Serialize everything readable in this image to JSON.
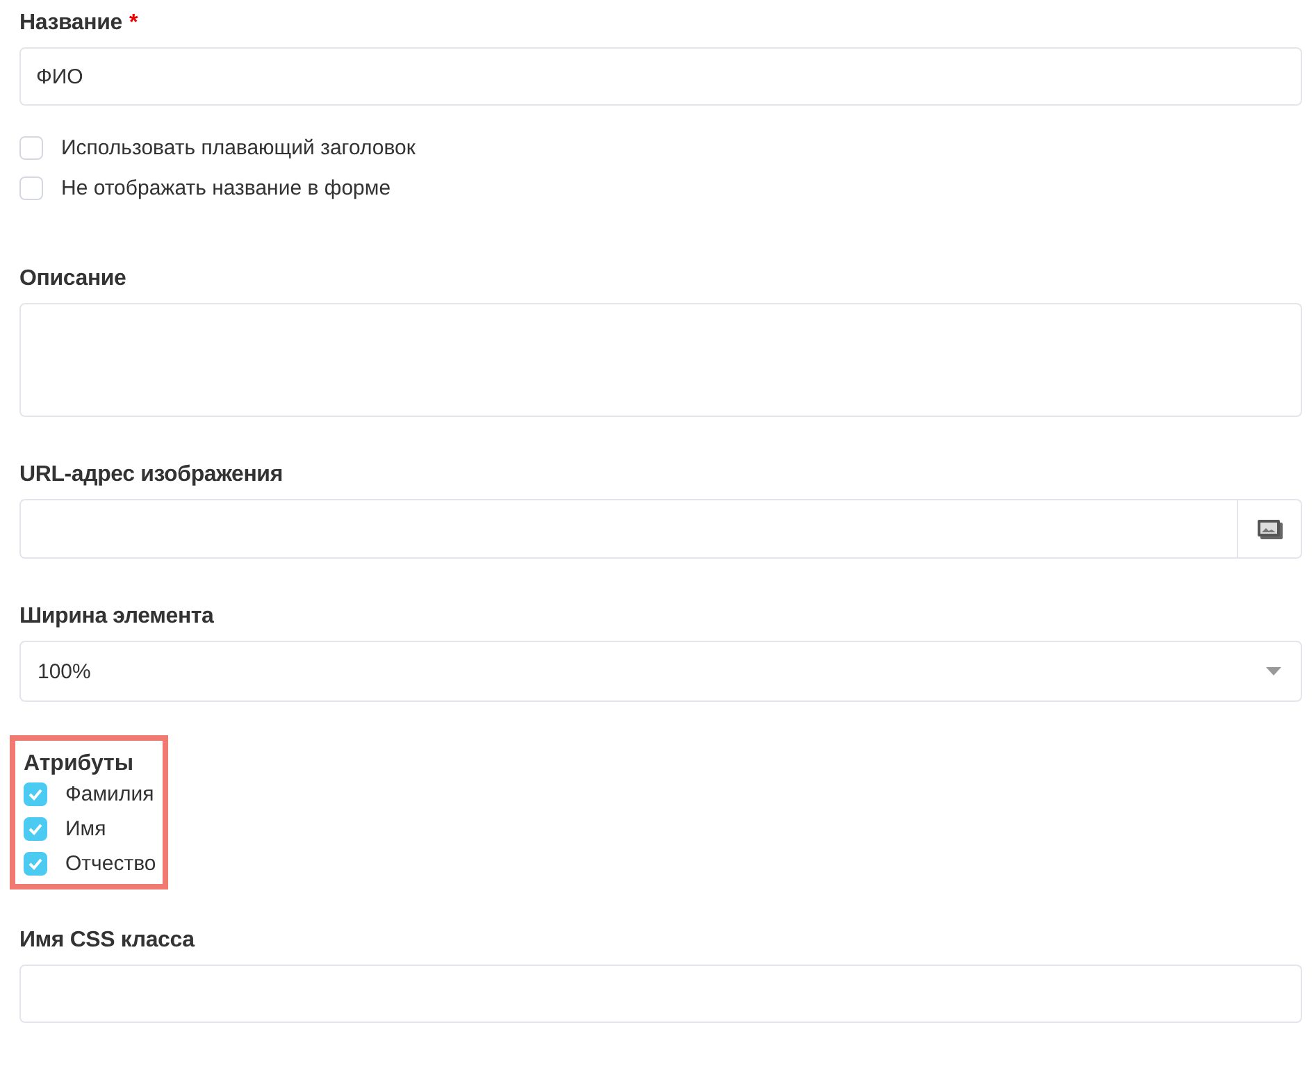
{
  "title_field": {
    "label": "Название",
    "required_mark": "*",
    "value": "ФИО"
  },
  "options": [
    {
      "label": "Использовать плавающий заголовок",
      "checked": false
    },
    {
      "label": "Не отображать название в форме",
      "checked": false
    }
  ],
  "description": {
    "label": "Описание"
  },
  "image_url": {
    "label": "URL-адрес изображения"
  },
  "element_width": {
    "label": "Ширина элемента",
    "value": "100%"
  },
  "attributes": {
    "label": "Атрибуты",
    "highlighted": true,
    "items": [
      {
        "label": "Фамилия",
        "checked": true
      },
      {
        "label": "Имя",
        "checked": true
      },
      {
        "label": "Отчество",
        "checked": true
      }
    ]
  },
  "css_class": {
    "label": "Имя CSS класса"
  }
}
